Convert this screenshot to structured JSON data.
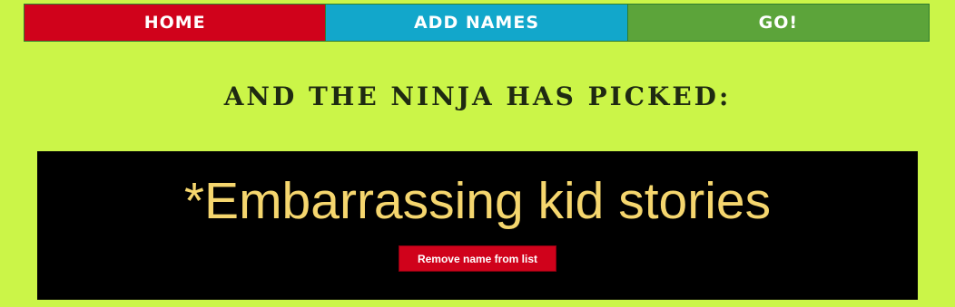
{
  "nav": {
    "items": [
      {
        "label": "HOME",
        "color": "#d0021b"
      },
      {
        "label": "ADD NAMES",
        "color": "#12a7cb"
      },
      {
        "label": "GO!",
        "color": "#5ca43a"
      }
    ]
  },
  "main": {
    "heading": "AND THE NINJA HAS PICKED:",
    "picked_name": "*Embarrassing kid stories",
    "remove_button_label": "Remove name from list"
  },
  "colors": {
    "page_background": "#cbf548",
    "result_background": "#000000",
    "picked_text": "#f5d66e",
    "button": "#d0021b"
  }
}
